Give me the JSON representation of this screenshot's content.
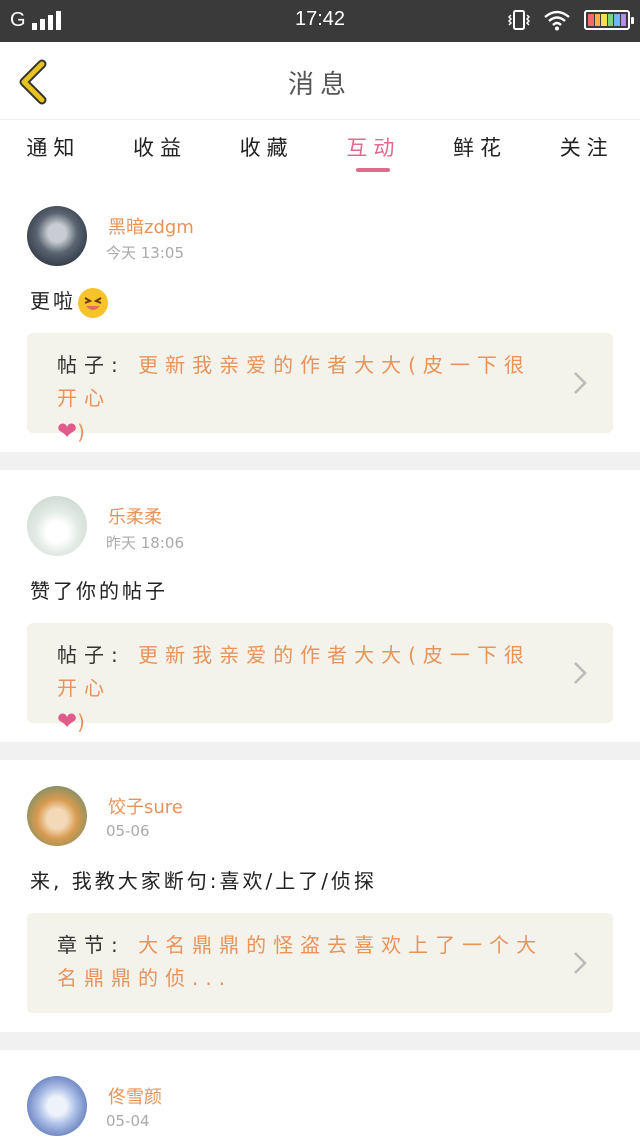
{
  "status_bar": {
    "network": "G",
    "time": "17:42"
  },
  "header": {
    "title": "消息"
  },
  "tabs": [
    {
      "label": "通知",
      "active": false
    },
    {
      "label": "收益",
      "active": false
    },
    {
      "label": "收藏",
      "active": false
    },
    {
      "label": "互动",
      "active": true
    },
    {
      "label": "鲜花",
      "active": false
    },
    {
      "label": "关注",
      "active": false
    }
  ],
  "messages": [
    {
      "username": "黑暗zdgm",
      "time": "今天 13:05",
      "text": "更啦",
      "quote_label": "帖子:",
      "quote_text": "更新我亲爱的作者大大(皮一下很开心",
      "quote_tail": ")"
    },
    {
      "username": "乐柔柔",
      "time": "昨天 18:06",
      "text": "赞了你的帖子",
      "quote_label": "帖子:",
      "quote_text": "更新我亲爱的作者大大(皮一下很开心",
      "quote_tail": ")"
    },
    {
      "username": "饺子sure",
      "time": "05-06",
      "text": "来, 我教大家断句:喜欢/上了/侦探",
      "quote_label": "章节:",
      "quote_text": "大名鼎鼎的怪盗去喜欢上了一个大名鼎鼎的侦...",
      "quote_tail": ""
    },
    {
      "username": "佟雪颜",
      "time": "05-04"
    }
  ],
  "icons": {
    "back": "chevron-left-icon",
    "vibrate": "vibrate-icon",
    "wifi": "wifi-icon",
    "battery": "battery-icon",
    "heart": "heart-icon",
    "emoji": "laughing-emoji-icon",
    "forward": "chevron-right-icon"
  },
  "colors": {
    "accent": "#e06b8c",
    "username": "#e8935a",
    "status_bar": "#3a3a3a",
    "back_arrow": "#e8c21e"
  }
}
